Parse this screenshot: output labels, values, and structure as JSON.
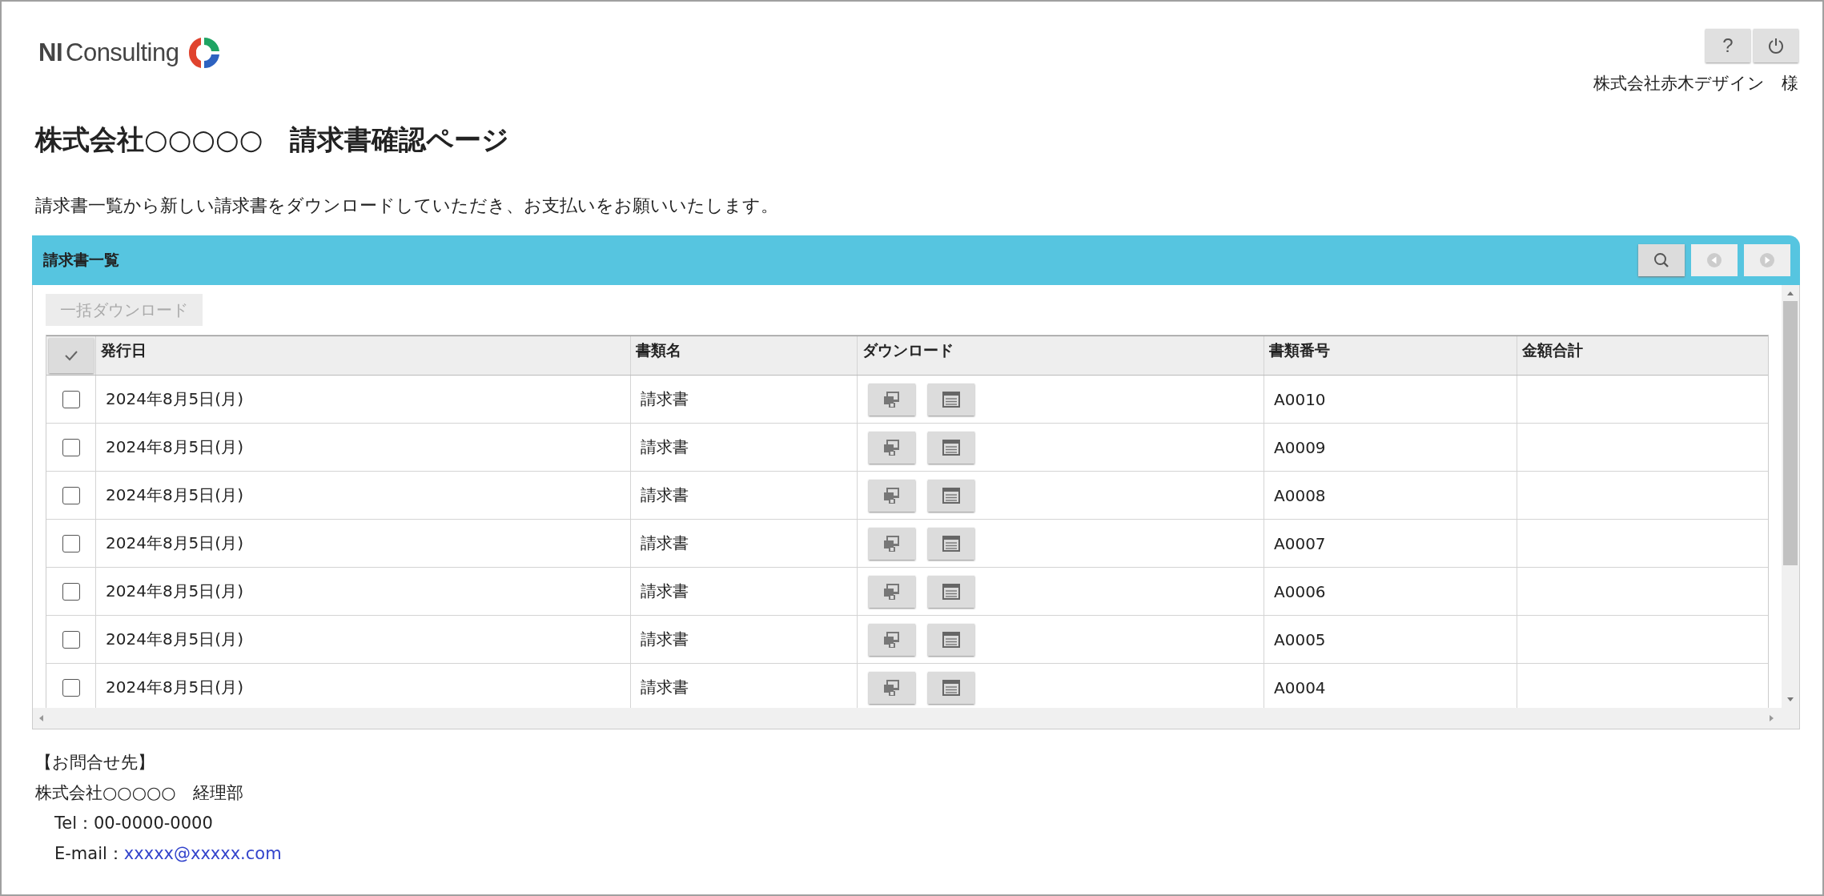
{
  "logo": {
    "bold": "NI",
    "text": "Consulting"
  },
  "header_buttons": [
    {
      "kind": "help",
      "label": "?"
    },
    {
      "kind": "power"
    }
  ],
  "user_name": "株式会社赤木デザイン　様",
  "page_title": "株式会社○○○○○　請求書確認ページ",
  "description": "請求書一覧から新しい請求書をダウンロードしていただき、お支払いをお願いいたします。",
  "panel": {
    "title": "請求書一覧",
    "tools": [
      {
        "kind": "search",
        "disabled": false
      },
      {
        "kind": "prev",
        "disabled": true
      },
      {
        "kind": "next",
        "disabled": true
      }
    ],
    "bulk_button": {
      "label": "一括ダウンロード",
      "disabled": true
    },
    "columns": [
      "発行日",
      "書類名",
      "ダウンロード",
      "書類番号",
      "金額合計"
    ],
    "rows": [
      {
        "checked": false,
        "date": "2024年8月5日(月)",
        "name": "請求書",
        "number": "A0010"
      },
      {
        "checked": false,
        "date": "2024年8月5日(月)",
        "name": "請求書",
        "number": "A0009"
      },
      {
        "checked": false,
        "date": "2024年8月5日(月)",
        "name": "請求書",
        "number": "A0008"
      },
      {
        "checked": false,
        "date": "2024年8月5日(月)",
        "name": "請求書",
        "number": "A0007"
      },
      {
        "checked": false,
        "date": "2024年8月5日(月)",
        "name": "請求書",
        "number": "A0006"
      },
      {
        "checked": false,
        "date": "2024年8月5日(月)",
        "name": "請求書",
        "number": "A0005"
      },
      {
        "checked": false,
        "date": "2024年8月5日(月)",
        "name": "請求書",
        "number": "A0004"
      }
    ]
  },
  "contact": {
    "heading": "【お問合せ先】",
    "company": "株式会社○○○○○　経理部",
    "tel": "Tel：00-0000-0000",
    "email_label": "E-mail：",
    "email": "xxxxx@xxxxx.com"
  }
}
